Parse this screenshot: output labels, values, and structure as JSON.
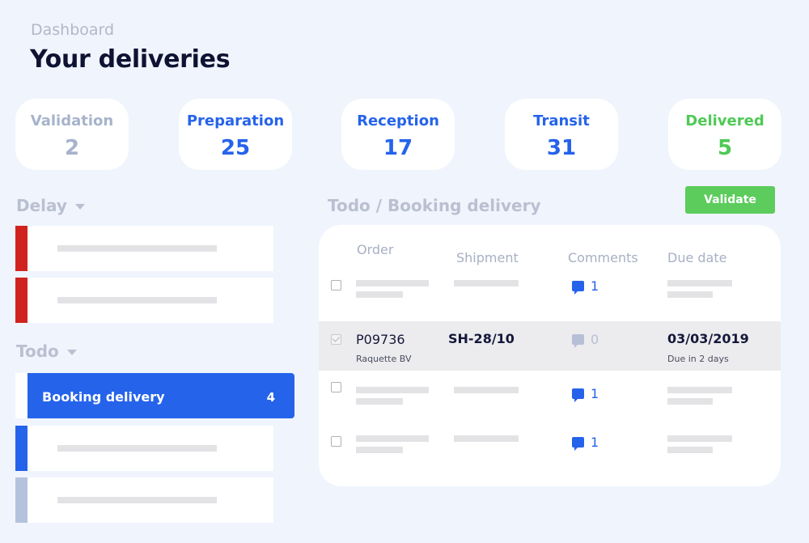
{
  "header": {
    "breadcrumb": "Dashboard",
    "title": "Your deliveries"
  },
  "stats": [
    {
      "label": "Validation",
      "value": "2"
    },
    {
      "label": "Preparation",
      "value": "25"
    },
    {
      "label": "Reception",
      "value": "17"
    },
    {
      "label": "Transit",
      "value": "31"
    },
    {
      "label": "Delivered",
      "value": "5"
    }
  ],
  "colors": {
    "accent": "#2563eb",
    "delivered": "#4fc955",
    "delay": "#d0231f",
    "muted": "#a7b3cb",
    "validate": "#5ccc5c"
  },
  "sidebar": {
    "delay_title": "Delay",
    "todo_title": "Todo",
    "booking_label": "Booking delivery",
    "booking_count": "4"
  },
  "main": {
    "breadcrumb": "Todo / Booking delivery",
    "validate_label": "Validate",
    "columns": [
      "Order",
      "Shipment",
      "Comments",
      "Due date"
    ],
    "rows": [
      {
        "checked": false,
        "comments": "1"
      },
      {
        "checked": true,
        "order": "P09736",
        "customer": "Raquette BV",
        "shipment": "SH-28/10",
        "comments": "0",
        "due": "03/03/2019",
        "due_hint": "Due in 2 days"
      },
      {
        "checked": false,
        "comments": "1"
      },
      {
        "checked": false,
        "comments": "1"
      }
    ]
  },
  "icons": [
    "caret-down-icon",
    "checkbox-icon",
    "comment-icon"
  ]
}
